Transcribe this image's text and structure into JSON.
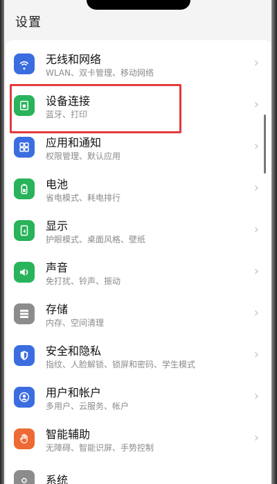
{
  "header": {
    "title": "设置"
  },
  "items": [
    {
      "title": "无线和网络",
      "sub": "WLAN、双卡管理、移动网络",
      "icon": "wifi-icon",
      "color": "#3b6de0"
    },
    {
      "title": "设备连接",
      "sub": "蓝牙、打印",
      "icon": "device-connect-icon",
      "color": "#29b35a"
    },
    {
      "title": "应用和通知",
      "sub": "权限管理、默认应用",
      "icon": "apps-icon",
      "color": "#3b6de0"
    },
    {
      "title": "电池",
      "sub": "省电模式、耗电排行",
      "icon": "battery-icon",
      "color": "#29b35a"
    },
    {
      "title": "显示",
      "sub": "护眼模式、桌面风格、壁纸",
      "icon": "display-icon",
      "color": "#29b35a"
    },
    {
      "title": "声音",
      "sub": "免打扰、铃声、振动",
      "icon": "sound-icon",
      "color": "#29b35a"
    },
    {
      "title": "存储",
      "sub": "内存、空间清理",
      "icon": "storage-icon",
      "color": "#8c8c8c"
    },
    {
      "title": "安全和隐私",
      "sub": "指纹、人脸解锁、锁屏和密码、学生模式",
      "icon": "shield-icon",
      "color": "#3b6de0"
    },
    {
      "title": "用户和帐户",
      "sub": "多用户、云服务、帐户",
      "icon": "user-icon",
      "color": "#3b6de0"
    },
    {
      "title": "智能辅助",
      "sub": "无障碍、智能识屏、手势控制",
      "icon": "hand-icon",
      "color": "#ee6a34"
    },
    {
      "title": "系统",
      "sub": "",
      "icon": "system-icon",
      "color": "#8c8c8c"
    }
  ],
  "chevron": "›"
}
